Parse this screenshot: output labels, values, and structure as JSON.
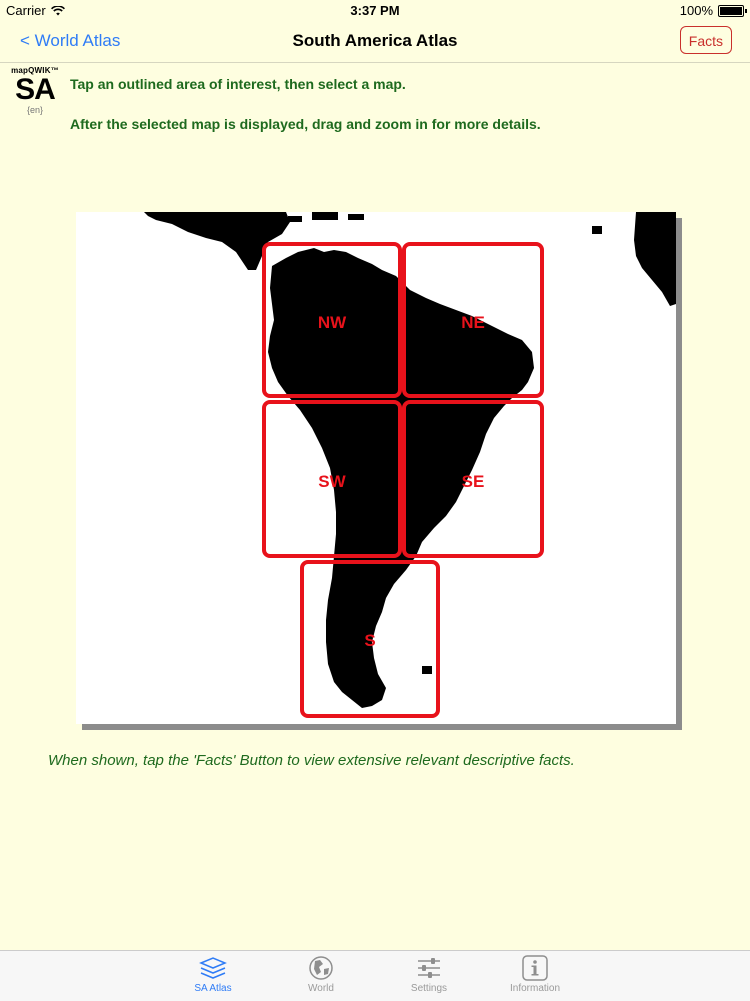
{
  "status": {
    "carrier": "Carrier",
    "time": "3:37 PM",
    "battery": "100%"
  },
  "nav": {
    "back_label": "< World Atlas",
    "title": "South America Atlas",
    "facts_label": "Facts"
  },
  "logo": {
    "top": "mapQWIK™",
    "code": "SA",
    "lang": "{en}"
  },
  "instructions": {
    "line1": "Tap an outlined area of interest, then select a map.",
    "line2": "After the selected map is displayed, drag and zoom in for more details."
  },
  "regions": {
    "nw": "NW",
    "ne": "NE",
    "sw": "SW",
    "se": "SE",
    "s": "S"
  },
  "footnote": "When shown, tap the 'Facts' Button to view extensive relevant descriptive facts.",
  "tabs": [
    {
      "label": "SA Atlas",
      "icon": "layers-icon",
      "active": true
    },
    {
      "label": "World",
      "icon": "globe-icon"
    },
    {
      "label": "Settings",
      "icon": "sliders-icon"
    },
    {
      "label": "Information",
      "icon": "info-icon"
    }
  ],
  "colors": {
    "accent": "#2f7cf6",
    "region_outline": "#e8121b",
    "instruction_text": "#1e6a1e",
    "background": "#fefee0"
  }
}
